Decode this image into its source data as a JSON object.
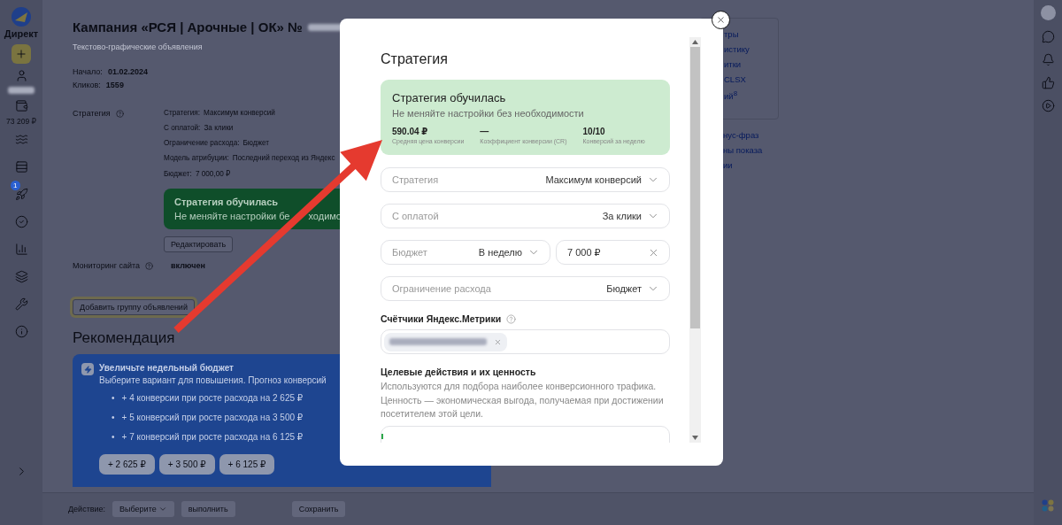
{
  "sidebar": {
    "brand": "Директ",
    "balance": "73 209 ₽",
    "badge": "1"
  },
  "campaign": {
    "title": "Кампания «РСЯ | Арочные | ОК» №",
    "subtitle": "Текстово-графические объявления",
    "facts": [
      {
        "label": "Начало:",
        "value": "01.02.2024"
      },
      {
        "label": "Кликов:",
        "value": "1559"
      }
    ],
    "strategy_label": "Стратегия",
    "strategy_details": [
      {
        "label": "Стратегия:",
        "value": "Максимум конверсий"
      },
      {
        "label": "С оплатой:",
        "value": "За клики"
      },
      {
        "label": "Ограничение расхода:",
        "value": "Бюджет"
      },
      {
        "label": "Модель атрибуции:",
        "value": "Последний переход из Яндекс"
      },
      {
        "label": "Бюджет:",
        "value": "7 000,00 ₽"
      }
    ],
    "status_card": {
      "title": "Стратегия обучилась",
      "text_parts": [
        "Не меняйте настройки бе",
        "ходимо"
      ]
    },
    "edit_button": "Редактировать",
    "monitoring": {
      "label": "Мониторинг сайта",
      "value": "включен"
    },
    "add_group_button": "Добавить группу объявлений"
  },
  "recommendation": {
    "heading": "Рекомендация",
    "title": "Увеличьте недельный бюджет",
    "text": "Выберите вариант для повышения. Прогноз конверсий",
    "bullet": "•",
    "options": [
      "+ 4 конверсии при росте расхода на 2 625 ₽",
      "+ 5 конверсий при росте расхода на 3 500 ₽",
      "+ 7 конверсий при росте расхода на 6 125 ₽"
    ],
    "buttons": [
      "+ 2 625 ₽",
      "+ 3 500 ₽",
      "+ 6 125 ₽"
    ]
  },
  "side_links": [
    "тры",
    "истику",
    "итки",
    "CLSX",
    "ий$^{8}$"
  ],
  "side_links_2": [
    "нус-фраз",
    "ны показа",
    "ии"
  ],
  "bottom_bar": {
    "action_label": "Действие:",
    "action_select": "Выберите",
    "run_button": "выполнить",
    "save_button": "Сохранить"
  },
  "modal": {
    "title": "Стратегия",
    "status": {
      "title": "Стратегия обучилась",
      "text": "Не меняйте настройки без необходимости",
      "stats": [
        {
          "value": "590.04 ₽",
          "label": "Средняя цена конверсии"
        },
        {
          "value": "—",
          "label": "Коэффициент конверсии (CR)"
        },
        {
          "value": "10/10",
          "label": "Конверсий за неделю"
        }
      ]
    },
    "fields": [
      {
        "kind": "select",
        "label": "Стратегия",
        "value": "Максимум конверсий"
      },
      {
        "kind": "select",
        "label": "С оплатой",
        "value": "За клики"
      },
      {
        "kind": "budget",
        "label": "Бюджет",
        "period": "В неделю",
        "amount": "7 000 ₽"
      },
      {
        "kind": "select",
        "label": "Ограничение расхода",
        "value": "Бюджет"
      }
    ],
    "counters_label": "Счётчики Яндекс.Метрики",
    "goals_title": "Целевые действия и их ценность",
    "goals_text": "Используются для подбора наиболее конверсионного трафика. Ценность — экономическая выгода, получаемая при достижении посетителем этой цели."
  }
}
